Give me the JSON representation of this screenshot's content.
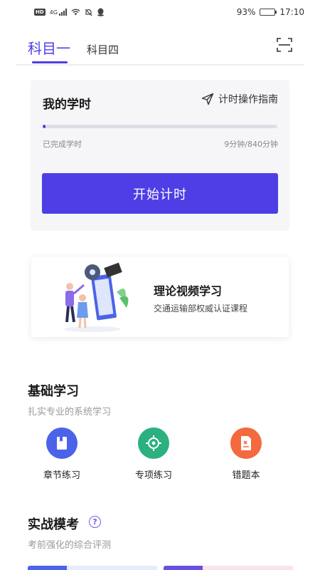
{
  "status_bar": {
    "battery": "93%",
    "time": "17:10",
    "hd": "HD",
    "network": "4G",
    "battery_level": 0.93
  },
  "tabs": {
    "items": [
      {
        "label": "科目一",
        "active": true
      },
      {
        "label": "科目四",
        "active": false
      }
    ],
    "scan_icon": "scan-icon"
  },
  "time_card": {
    "title": "我的学时",
    "guide_label": "计时操作指南",
    "guide_icon": "paper-plane-icon",
    "progress_label": "已完成学时",
    "progress_value": "9分钟/840分钟",
    "progress_fraction": 0.0107,
    "start_button": "开始计时"
  },
  "video_card": {
    "title": "理论视频学习",
    "subtitle": "交通运输部权威认证课程"
  },
  "basic": {
    "title": "基础学习",
    "subtitle": "扎实专业的系统学习",
    "items": [
      {
        "label": "章节练习",
        "icon": "book-icon",
        "color": "#4a63e8"
      },
      {
        "label": "专项练习",
        "icon": "target-icon",
        "color": "#2bb07f"
      },
      {
        "label": "错题本",
        "icon": "wrong-doc-icon",
        "color": "#f26a3d"
      }
    ]
  },
  "exam": {
    "title": "实战模考",
    "subtitle": "考前强化的综合评测",
    "help_icon": "question-icon",
    "help_glyph": "?"
  },
  "colors": {
    "accent": "#4f3ee6",
    "card_bg": "#f6f6f8",
    "muted": "#999999"
  }
}
